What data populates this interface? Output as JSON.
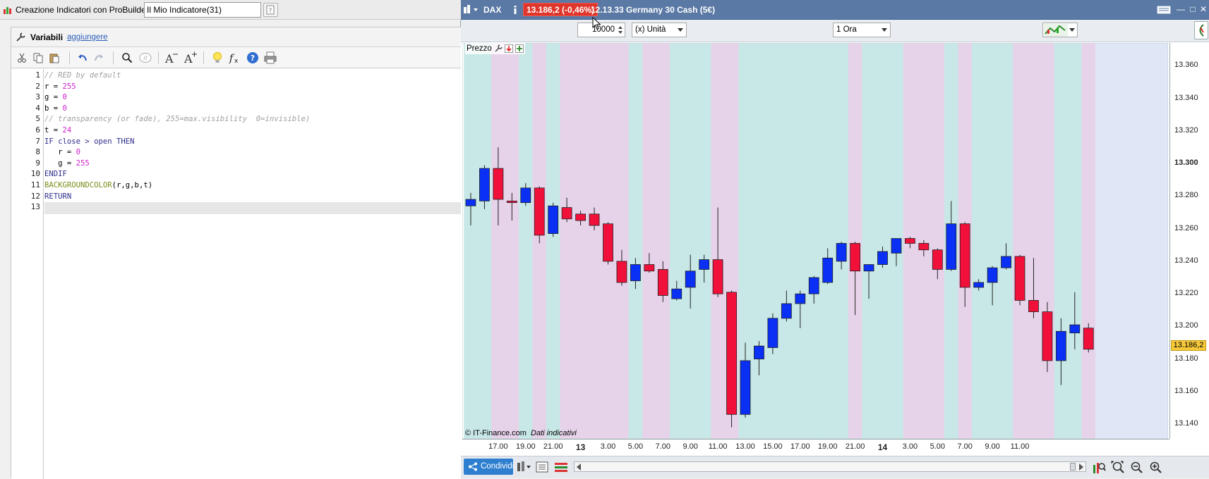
{
  "editor": {
    "window_title": "Creazione Indicatori con ProBuilder  -",
    "indicator_name": "Il Mio Indicatore(31)",
    "variables_label": "Variabili",
    "add_link": "aggiungere",
    "lines": [
      {
        "n": "1",
        "tokens": [
          {
            "t": "// RED by default",
            "c": "cm"
          }
        ]
      },
      {
        "n": "2",
        "tokens": [
          {
            "t": "r = ",
            "c": "id"
          },
          {
            "t": "255",
            "c": "num"
          }
        ]
      },
      {
        "n": "3",
        "tokens": [
          {
            "t": "g = ",
            "c": "id"
          },
          {
            "t": "0",
            "c": "num"
          }
        ]
      },
      {
        "n": "4",
        "tokens": [
          {
            "t": "b = ",
            "c": "id"
          },
          {
            "t": "0",
            "c": "num"
          }
        ]
      },
      {
        "n": "5",
        "tokens": [
          {
            "t": "// transparency (or fade), 255=max.visibility  0=invisible)",
            "c": "cm"
          }
        ]
      },
      {
        "n": "6",
        "tokens": [
          {
            "t": "t = ",
            "c": "id"
          },
          {
            "t": "24",
            "c": "num"
          }
        ]
      },
      {
        "n": "7",
        "tokens": [
          {
            "t": "IF close > open THEN",
            "c": "kw"
          }
        ]
      },
      {
        "n": "8",
        "tokens": [
          {
            "t": "   r = ",
            "c": "id"
          },
          {
            "t": "0",
            "c": "num"
          }
        ]
      },
      {
        "n": "9",
        "tokens": [
          {
            "t": "   g = ",
            "c": "id"
          },
          {
            "t": "255",
            "c": "num"
          }
        ]
      },
      {
        "n": "10",
        "tokens": [
          {
            "t": "ENDIF",
            "c": "kw"
          }
        ]
      },
      {
        "n": "11",
        "tokens": [
          {
            "t": "BACKGROUNDCOLOR",
            "c": "fn"
          },
          {
            "t": "(r,g,b,t)",
            "c": "id"
          }
        ]
      },
      {
        "n": "12",
        "tokens": [
          {
            "t": "RETURN",
            "c": "kw"
          }
        ]
      },
      {
        "n": "13",
        "tokens": []
      }
    ]
  },
  "chart": {
    "instrument": "DAX",
    "price_badge": "13.186,2 (-0,46%)",
    "description": "12.13.33 Germany 30 Cash (5€)",
    "units_value": "10000",
    "units_label": "(x) Unità",
    "timeframe": "1 Ora",
    "price_label": "Prezzo",
    "copyright": "© IT-Finance.com",
    "data_note": "Dati indicativi",
    "last_price_tag": "13.186,2",
    "share_label": "Condividi",
    "colors": {
      "bull": "#0a2ff5",
      "bear": "#f0103a",
      "bull_bg": "#c7e8e6",
      "bear_bg": "#e6d3ea",
      "last_price_bg": "#f6c93b"
    }
  },
  "chart_data": {
    "type": "candlestick",
    "timeframe": "1 Ora",
    "y_ticks": [
      "13.360",
      "13.340",
      "13.320",
      "13.300",
      "13.280",
      "13.260",
      "13.240",
      "13.220",
      "13.200",
      "13.180",
      "13.160",
      "13.140"
    ],
    "y_bold_tick": "13.300",
    "ylim": [
      13131,
      13374
    ],
    "x_ticks": [
      "17.00",
      "19.00",
      "21.00",
      "13",
      "3.00",
      "5.00",
      "7.00",
      "9.00",
      "11.00",
      "13.00",
      "15.00",
      "17.00",
      "19.00",
      "21.00",
      "14",
      "3.00",
      "5.00",
      "7.00",
      "9.00",
      "11.00"
    ],
    "x_bold_ticks": [
      "13",
      "14"
    ],
    "candles": [
      {
        "o": 13274,
        "h": 13282,
        "l": 13262,
        "c": 13278
      },
      {
        "o": 13277,
        "h": 13299,
        "l": 13272,
        "c": 13297
      },
      {
        "o": 13297,
        "h": 13310,
        "l": 13262,
        "c": 13278
      },
      {
        "o": 13277,
        "h": 13282,
        "l": 13265,
        "c": 13276
      },
      {
        "o": 13276,
        "h": 13288,
        "l": 13274,
        "c": 13285
      },
      {
        "o": 13285,
        "h": 13286,
        "l": 13251,
        "c": 13256
      },
      {
        "o": 13257,
        "h": 13276,
        "l": 13255,
        "c": 13274
      },
      {
        "o": 13273,
        "h": 13279,
        "l": 13264,
        "c": 13266
      },
      {
        "o": 13269,
        "h": 13271,
        "l": 13262,
        "c": 13265
      },
      {
        "o": 13269,
        "h": 13273,
        "l": 13259,
        "c": 13262
      },
      {
        "o": 13263,
        "h": 13264,
        "l": 13238,
        "c": 13240
      },
      {
        "o": 13240,
        "h": 13247,
        "l": 13225,
        "c": 13227
      },
      {
        "o": 13228,
        "h": 13242,
        "l": 13223,
        "c": 13238
      },
      {
        "o": 13238,
        "h": 13245,
        "l": 13233,
        "c": 13234
      },
      {
        "o": 13235,
        "h": 13240,
        "l": 13215,
        "c": 13219
      },
      {
        "o": 13217,
        "h": 13228,
        "l": 13216,
        "c": 13223
      },
      {
        "o": 13224,
        "h": 13244,
        "l": 13211,
        "c": 13234
      },
      {
        "o": 13235,
        "h": 13244,
        "l": 13227,
        "c": 13241
      },
      {
        "o": 13241,
        "h": 13273,
        "l": 13218,
        "c": 13220
      },
      {
        "o": 13221,
        "h": 13222,
        "l": 13138,
        "c": 13146
      },
      {
        "o": 13146,
        "h": 13190,
        "l": 13144,
        "c": 13179
      },
      {
        "o": 13180,
        "h": 13191,
        "l": 13170,
        "c": 13188
      },
      {
        "o": 13187,
        "h": 13208,
        "l": 13183,
        "c": 13205
      },
      {
        "o": 13205,
        "h": 13222,
        "l": 13203,
        "c": 13214
      },
      {
        "o": 13214,
        "h": 13222,
        "l": 13199,
        "c": 13220
      },
      {
        "o": 13220,
        "h": 13231,
        "l": 13214,
        "c": 13230
      },
      {
        "o": 13227,
        "h": 13248,
        "l": 13226,
        "c": 13242
      },
      {
        "o": 13240,
        "h": 13252,
        "l": 13235,
        "c": 13251
      },
      {
        "o": 13251,
        "h": 13252,
        "l": 13207,
        "c": 13234
      },
      {
        "o": 13234,
        "h": 13238,
        "l": 13217,
        "c": 13238
      },
      {
        "o": 13238,
        "h": 13249,
        "l": 13236,
        "c": 13246
      },
      {
        "o": 13245,
        "h": 13254,
        "l": 13237,
        "c": 13254
      },
      {
        "o": 13254,
        "h": 13255,
        "l": 13248,
        "c": 13251
      },
      {
        "o": 13251,
        "h": 13253,
        "l": 13243,
        "c": 13247
      },
      {
        "o": 13247,
        "h": 13248,
        "l": 13229,
        "c": 13235
      },
      {
        "o": 13235,
        "h": 13277,
        "l": 13234,
        "c": 13263
      },
      {
        "o": 13263,
        "h": 13264,
        "l": 13212,
        "c": 13224
      },
      {
        "o": 13224,
        "h": 13229,
        "l": 13222,
        "c": 13227
      },
      {
        "o": 13227,
        "h": 13237,
        "l": 13213,
        "c": 13236
      },
      {
        "o": 13236,
        "h": 13251,
        "l": 13235,
        "c": 13243
      },
      {
        "o": 13243,
        "h": 13244,
        "l": 13213,
        "c": 13216
      },
      {
        "o": 13216,
        "h": 13242,
        "l": 13205,
        "c": 13209
      },
      {
        "o": 13209,
        "h": 13215,
        "l": 13172,
        "c": 13179
      },
      {
        "o": 13179,
        "h": 13205,
        "l": 13164,
        "c": 13197
      },
      {
        "o": 13196,
        "h": 13221,
        "l": 13186,
        "c": 13201
      },
      {
        "o": 13199,
        "h": 13202,
        "l": 13184,
        "c": 13186
      }
    ]
  }
}
